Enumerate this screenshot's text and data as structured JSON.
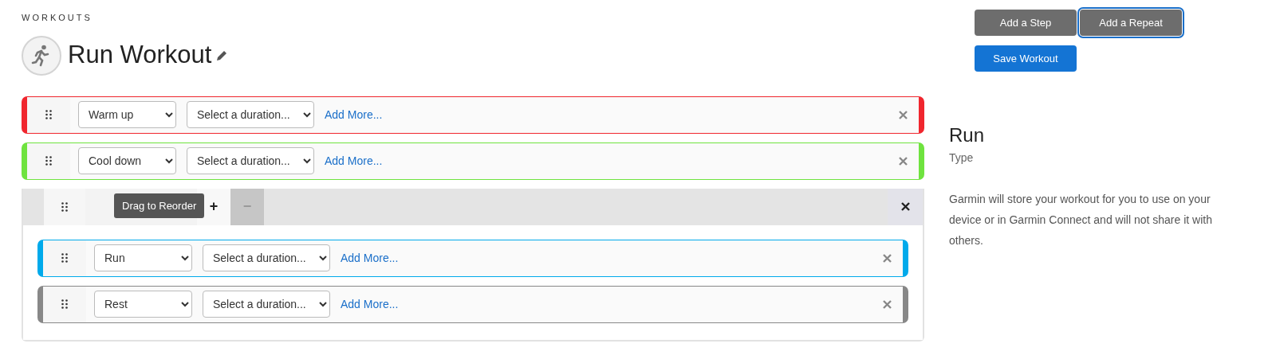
{
  "breadcrumb": "WORKOUTS",
  "title": "Run Workout",
  "steps": [
    {
      "kind": "step",
      "color": "#f0262e",
      "type": "Warm up",
      "duration": "Select a duration...",
      "add_more": "Add More..."
    },
    {
      "kind": "step",
      "color": "#6fe33f",
      "type": "Cool down",
      "duration": "Select a duration...",
      "add_more": "Add More..."
    },
    {
      "kind": "repeat",
      "tooltip": "Drag to Reorder",
      "plus": "+",
      "minus": "−",
      "children": [
        {
          "kind": "step",
          "color": "#00aaeb",
          "type": "Run",
          "duration": "Select a duration...",
          "add_more": "Add More..."
        },
        {
          "kind": "step",
          "color": "#888888",
          "type": "Rest",
          "duration": "Select a duration...",
          "add_more": "Add More..."
        }
      ]
    }
  ],
  "buttons": [
    {
      "label": "Add a Step",
      "focused": false
    },
    {
      "label": "Add a Repeat",
      "focused": true
    }
  ],
  "save": "Save Workout",
  "sport": {
    "name": "Run",
    "label": "Type"
  },
  "note": "Garmin will store your workout for you to use on your device or in Garmin Connect and will not share it with others."
}
